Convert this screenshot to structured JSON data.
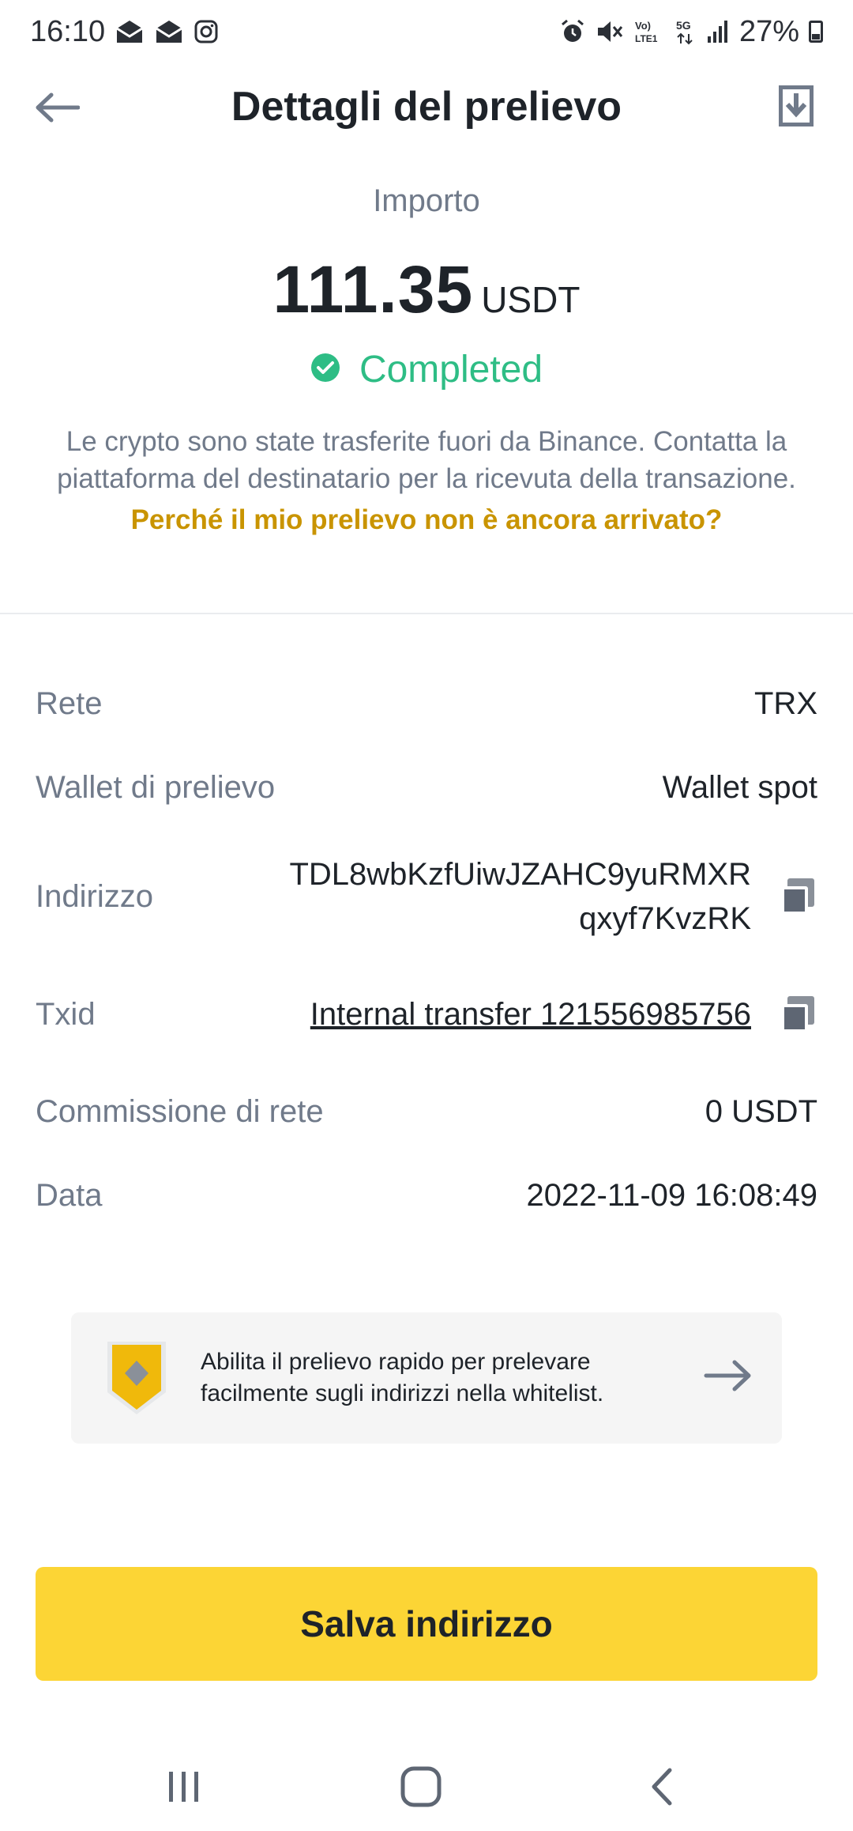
{
  "status_bar": {
    "time": "16:10",
    "battery": "27%",
    "network": "5G",
    "left_icons": [
      "email-icon",
      "email-icon",
      "instagram-icon"
    ],
    "right_icons": [
      "alarm-icon",
      "mute-icon",
      "volte-icon",
      "5g-icon",
      "signal-icon",
      "battery-icon"
    ]
  },
  "header": {
    "title": "Dettagli del prelievo",
    "back_icon": "back-arrow-icon",
    "download_icon": "download-icon"
  },
  "amount": {
    "label": "Importo",
    "value": "111.35",
    "currency": "USDT",
    "status": "Completed",
    "status_color": "#2ebd85",
    "description": "Le crypto sono state trasferite fuori da Binance. Contatta la piattaforma del destinatario per la ricevuta della transazione.",
    "help_link": "Perché il mio prelievo non è ancora arrivato?",
    "help_color": "#c99400"
  },
  "details": {
    "network": {
      "label": "Rete",
      "value": "TRX"
    },
    "wallet": {
      "label": "Wallet di prelievo",
      "value": "Wallet spot"
    },
    "address": {
      "label": "Indirizzo",
      "line1": "TDL8wbKzfUiwJZAHC9yuRMXR",
      "line2": "qxyf7KvzRK"
    },
    "txid": {
      "label": "Txid",
      "value": "Internal transfer 121556985756"
    },
    "fee": {
      "label": "Commissione di rete",
      "value": "0 USDT"
    },
    "date": {
      "label": "Data",
      "value": "2022-11-09 16:08:49"
    }
  },
  "promo": {
    "text": "Abilita il prelievo rapido per prelevare facilmente sugli indirizzi nella whitelist."
  },
  "actions": {
    "save_label": "Salva indirizzo",
    "accent": "#fcd535"
  },
  "navbar": {
    "icons": [
      "recent-apps-icon",
      "home-icon",
      "back-icon"
    ]
  }
}
